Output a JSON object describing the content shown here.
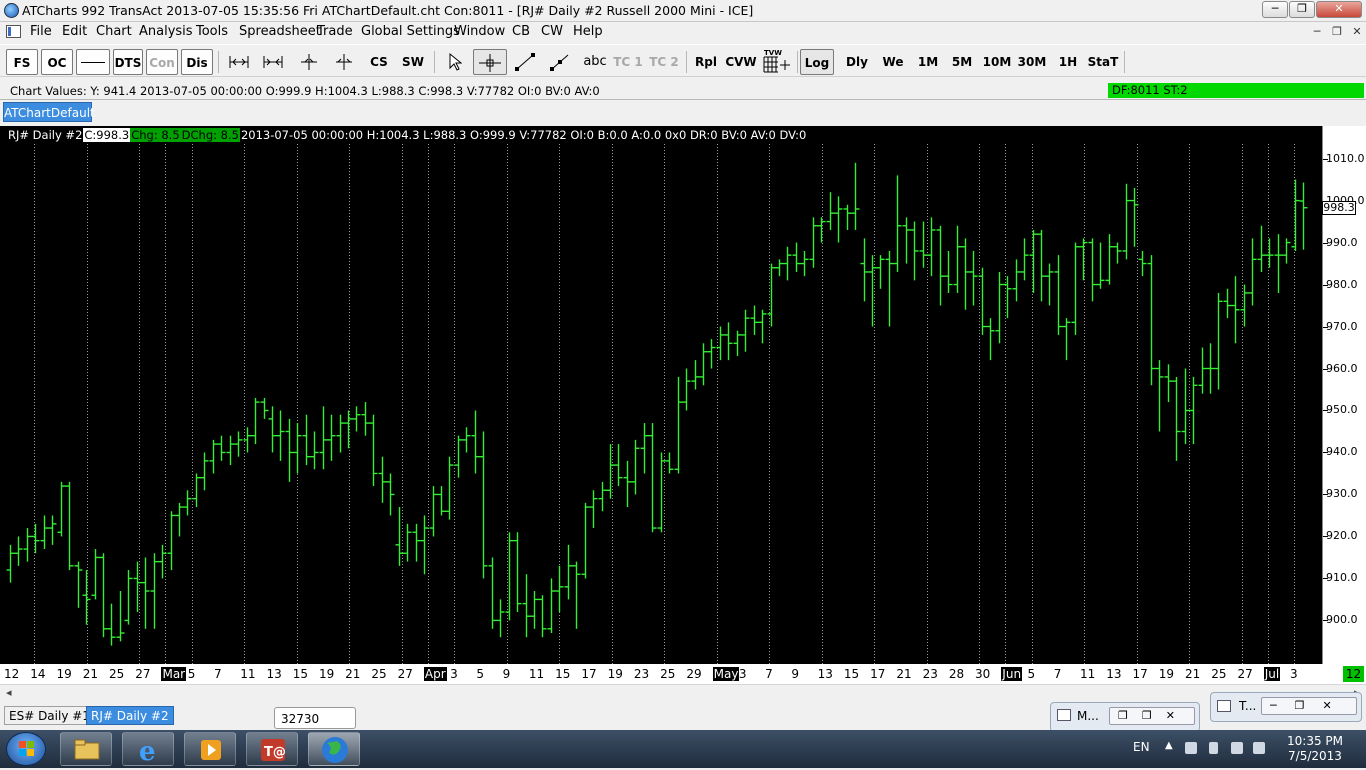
{
  "window": {
    "title": "ATCharts 992 TransAct 2013-07-05  15:35:56 Fri  ATChartDefault.cht Con:8011 - [RJ#  Daily  #2  Russell 2000 Mini - ICE]",
    "minimize": "─",
    "restore": "❐",
    "close": "✕"
  },
  "menu": {
    "items": [
      "File",
      "Edit",
      "Chart",
      "Analysis",
      "Tools",
      "Spreadsheet",
      "Trade",
      "Global Settings",
      "Window",
      "CB",
      "CW",
      "Help"
    ],
    "mdi_minimize": "─",
    "mdi_restore": "❐",
    "mdi_close": "✕"
  },
  "toolbar": {
    "fs": "FS",
    "oc": "OC",
    "dts": "DTS",
    "con": "Con",
    "dis": "Dis",
    "cs": "CS",
    "sw": "SW",
    "abc": "abc",
    "tc1": "TC 1",
    "tc2": "TC 2",
    "rpl": "Rpl",
    "cvw": "CVW",
    "tvw": "TVW",
    "log": "Log",
    "dly": "Dly",
    "we": "We",
    "m1": "1M",
    "m5": "5M",
    "m10": "10M",
    "m30": "30M",
    "h1": "1H",
    "stat": "StaT"
  },
  "values_bar": {
    "text": "Chart Values: Y: 941.4  2013-07-05  00:00:00  O:999.9  H:1004.3  L:988.3  C:998.3  V:77782  OI:0  BV:0  AV:0",
    "df_status": "DF:8011   ST:2"
  },
  "chart_tab": "ATChartDefault",
  "info_line": {
    "symbol": "RJ#  Daily  #2",
    "close": "C:998.3",
    "chg": "Chg: 8.5",
    "dchg": "DChg: 8.5",
    "details": "2013-07-05 00:00:00 H:1004.3 L:988.3 O:999.9 V:77782 OI:0 B:0.0 A:0.0 0x0 DR:0 BV:0 AV:0 DV:0"
  },
  "last_price": "998.3",
  "bottom_tabs": [
    "ES#  Daily  #1",
    "RJ#  Daily  #2"
  ],
  "tooltip": "32730",
  "minimized_windows": [
    {
      "label": "M..."
    },
    {
      "label": "T..."
    }
  ],
  "taskbar": {
    "language": "EN",
    "time": "10:35 PM",
    "date": "7/5/2013"
  },
  "colors": {
    "bars": "#33ee33",
    "chart_bg": "#000000",
    "df_status": "#00d800",
    "tab_active": "#3c8de0"
  },
  "chart_data": {
    "type": "ohlc",
    "ylim": [
      892,
      1013
    ],
    "y_ticks": [
      "1010.0",
      "1000.0",
      "990.0",
      "980.0",
      "970.0",
      "960.0",
      "950.0",
      "940.0",
      "930.0",
      "920.0",
      "910.0",
      "900.0"
    ],
    "y_tick_values": [
      1010,
      1000,
      990,
      980,
      970,
      960,
      950,
      940,
      930,
      920,
      910,
      900
    ],
    "x_labels": [
      "12",
      "14",
      "19",
      "21",
      "25",
      "27",
      "Mar",
      "5",
      "7",
      "11",
      "13",
      "15",
      "19",
      "21",
      "25",
      "27",
      "Apr",
      "3",
      "5",
      "9",
      "11",
      "15",
      "17",
      "19",
      "23",
      "25",
      "29",
      "May",
      "3",
      "7",
      "9",
      "13",
      "15",
      "17",
      "21",
      "23",
      "28",
      "30",
      "Jun",
      "5",
      "7",
      "11",
      "13",
      "17",
      "19",
      "21",
      "25",
      "27",
      "Jul",
      "3"
    ],
    "x_end_label": "12",
    "month_labels": [
      "Mar",
      "Apr",
      "May",
      "Jun",
      "Jul"
    ],
    "bars": [
      {
        "o": 912,
        "h": 918,
        "l": 909,
        "c": 916
      },
      {
        "o": 916,
        "h": 920,
        "l": 913,
        "c": 917
      },
      {
        "o": 917,
        "h": 922,
        "l": 914,
        "c": 920
      },
      {
        "o": 920,
        "h": 923,
        "l": 916,
        "c": 919
      },
      {
        "o": 919,
        "h": 925,
        "l": 917,
        "c": 922
      },
      {
        "o": 922,
        "h": 925,
        "l": 918,
        "c": 923
      },
      {
        "o": 921,
        "h": 933,
        "l": 920,
        "c": 932
      },
      {
        "o": 932,
        "h": 933,
        "l": 912,
        "c": 913
      },
      {
        "o": 913,
        "h": 914,
        "l": 903,
        "c": 912
      },
      {
        "o": 906,
        "h": 912,
        "l": 899,
        "c": 905
      },
      {
        "o": 906,
        "h": 917,
        "l": 905,
        "c": 915
      },
      {
        "o": 915,
        "h": 916,
        "l": 896,
        "c": 898
      },
      {
        "o": 898,
        "h": 904,
        "l": 894,
        "c": 896
      },
      {
        "o": 896,
        "h": 907,
        "l": 895,
        "c": 897
      },
      {
        "o": 900,
        "h": 912,
        "l": 899,
        "c": 910
      },
      {
        "o": 910,
        "h": 914,
        "l": 902,
        "c": 909
      },
      {
        "o": 909,
        "h": 915,
        "l": 898,
        "c": 907
      },
      {
        "o": 907,
        "h": 916,
        "l": 898,
        "c": 914
      },
      {
        "o": 914,
        "h": 918,
        "l": 910,
        "c": 916
      },
      {
        "o": 916,
        "h": 926,
        "l": 912,
        "c": 925
      },
      {
        "o": 925,
        "h": 928,
        "l": 920,
        "c": 927
      },
      {
        "o": 927,
        "h": 931,
        "l": 925,
        "c": 929
      },
      {
        "o": 929,
        "h": 935,
        "l": 927,
        "c": 934
      },
      {
        "o": 934,
        "h": 940,
        "l": 931,
        "c": 938
      },
      {
        "o": 938,
        "h": 943,
        "l": 935,
        "c": 942
      },
      {
        "o": 942,
        "h": 944,
        "l": 938,
        "c": 940
      },
      {
        "o": 940,
        "h": 944,
        "l": 937,
        "c": 942
      },
      {
        "o": 942,
        "h": 945,
        "l": 939,
        "c": 943
      },
      {
        "o": 943,
        "h": 946,
        "l": 940,
        "c": 944
      },
      {
        "o": 944,
        "h": 953,
        "l": 942,
        "c": 952
      },
      {
        "o": 952,
        "h": 953,
        "l": 948,
        "c": 950
      },
      {
        "o": 948,
        "h": 951,
        "l": 940,
        "c": 944
      },
      {
        "o": 944,
        "h": 950,
        "l": 938,
        "c": 945
      },
      {
        "o": 945,
        "h": 948,
        "l": 933,
        "c": 940
      },
      {
        "o": 940,
        "h": 947,
        "l": 935,
        "c": 944
      },
      {
        "o": 944,
        "h": 949,
        "l": 937,
        "c": 939
      },
      {
        "o": 939,
        "h": 945,
        "l": 936,
        "c": 940
      },
      {
        "o": 940,
        "h": 951,
        "l": 936,
        "c": 943
      },
      {
        "o": 943,
        "h": 949,
        "l": 938,
        "c": 944
      },
      {
        "o": 944,
        "h": 949,
        "l": 940,
        "c": 947
      },
      {
        "o": 947,
        "h": 950,
        "l": 941,
        "c": 948
      },
      {
        "o": 948,
        "h": 951,
        "l": 945,
        "c": 949
      },
      {
        "o": 949,
        "h": 952,
        "l": 944,
        "c": 947
      },
      {
        "o": 947,
        "h": 949,
        "l": 932,
        "c": 935
      },
      {
        "o": 935,
        "h": 939,
        "l": 928,
        "c": 933
      },
      {
        "o": 933,
        "h": 935,
        "l": 925,
        "c": 930
      },
      {
        "o": 918,
        "h": 927,
        "l": 913,
        "c": 916
      },
      {
        "o": 916,
        "h": 923,
        "l": 914,
        "c": 921
      },
      {
        "o": 921,
        "h": 923,
        "l": 914,
        "c": 919
      },
      {
        "o": 919,
        "h": 925,
        "l": 911,
        "c": 922
      },
      {
        "o": 922,
        "h": 932,
        "l": 920,
        "c": 930
      },
      {
        "o": 930,
        "h": 932,
        "l": 925,
        "c": 926
      },
      {
        "o": 926,
        "h": 939,
        "l": 924,
        "c": 937
      },
      {
        "o": 937,
        "h": 944,
        "l": 934,
        "c": 943
      },
      {
        "o": 943,
        "h": 946,
        "l": 940,
        "c": 944
      },
      {
        "o": 944,
        "h": 950,
        "l": 935,
        "c": 939
      },
      {
        "o": 939,
        "h": 945,
        "l": 910,
        "c": 913
      },
      {
        "o": 913,
        "h": 915,
        "l": 898,
        "c": 900
      },
      {
        "o": 900,
        "h": 905,
        "l": 896,
        "c": 902
      },
      {
        "o": 902,
        "h": 921,
        "l": 900,
        "c": 919
      },
      {
        "o": 919,
        "h": 921,
        "l": 902,
        "c": 904
      },
      {
        "o": 904,
        "h": 911,
        "l": 896,
        "c": 901
      },
      {
        "o": 901,
        "h": 907,
        "l": 898,
        "c": 905
      },
      {
        "o": 905,
        "h": 906,
        "l": 896,
        "c": 898
      },
      {
        "o": 898,
        "h": 910,
        "l": 897,
        "c": 907
      },
      {
        "o": 907,
        "h": 913,
        "l": 902,
        "c": 908
      },
      {
        "o": 908,
        "h": 918,
        "l": 905,
        "c": 913
      },
      {
        "o": 913,
        "h": 914,
        "l": 898,
        "c": 911
      },
      {
        "o": 911,
        "h": 928,
        "l": 910,
        "c": 927
      },
      {
        "o": 927,
        "h": 931,
        "l": 922,
        "c": 929
      },
      {
        "o": 929,
        "h": 933,
        "l": 926,
        "c": 931
      },
      {
        "o": 931,
        "h": 942,
        "l": 929,
        "c": 937
      },
      {
        "o": 937,
        "h": 942,
        "l": 932,
        "c": 934
      },
      {
        "o": 934,
        "h": 938,
        "l": 927,
        "c": 933
      },
      {
        "o": 933,
        "h": 943,
        "l": 930,
        "c": 941
      },
      {
        "o": 941,
        "h": 947,
        "l": 935,
        "c": 944
      },
      {
        "o": 944,
        "h": 947,
        "l": 921,
        "c": 922
      },
      {
        "o": 922,
        "h": 940,
        "l": 921,
        "c": 938
      },
      {
        "o": 938,
        "h": 940,
        "l": 935,
        "c": 936
      },
      {
        "o": 936,
        "h": 958,
        "l": 935,
        "c": 952
      },
      {
        "o": 952,
        "h": 960,
        "l": 950,
        "c": 957
      },
      {
        "o": 957,
        "h": 962,
        "l": 955,
        "c": 958
      },
      {
        "o": 958,
        "h": 966,
        "l": 956,
        "c": 964
      },
      {
        "o": 964,
        "h": 967,
        "l": 960,
        "c": 965
      },
      {
        "o": 965,
        "h": 970,
        "l": 962,
        "c": 968
      },
      {
        "o": 968,
        "h": 971,
        "l": 962,
        "c": 966
      },
      {
        "o": 966,
        "h": 969,
        "l": 963,
        "c": 968
      },
      {
        "o": 968,
        "h": 974,
        "l": 964,
        "c": 972
      },
      {
        "o": 972,
        "h": 975,
        "l": 968,
        "c": 971
      },
      {
        "o": 971,
        "h": 974,
        "l": 966,
        "c": 973
      },
      {
        "o": 973,
        "h": 985,
        "l": 970,
        "c": 984
      },
      {
        "o": 984,
        "h": 986,
        "l": 982,
        "c": 985
      },
      {
        "o": 985,
        "h": 989,
        "l": 981,
        "c": 987
      },
      {
        "o": 987,
        "h": 990,
        "l": 983,
        "c": 985
      },
      {
        "o": 985,
        "h": 988,
        "l": 982,
        "c": 986
      },
      {
        "o": 986,
        "h": 996,
        "l": 984,
        "c": 994
      },
      {
        "o": 994,
        "h": 996,
        "l": 990,
        "c": 995
      },
      {
        "o": 995,
        "h": 1002,
        "l": 993,
        "c": 997
      },
      {
        "o": 997,
        "h": 1001,
        "l": 990,
        "c": 998
      },
      {
        "o": 998,
        "h": 999,
        "l": 993,
        "c": 997
      },
      {
        "o": 997,
        "h": 1009,
        "l": 993,
        "c": 998
      },
      {
        "o": 985,
        "h": 991,
        "l": 976,
        "c": 983
      },
      {
        "o": 983,
        "h": 987,
        "l": 970,
        "c": 984
      },
      {
        "o": 984,
        "h": 987,
        "l": 979,
        "c": 986
      },
      {
        "o": 986,
        "h": 988,
        "l": 970,
        "c": 985
      },
      {
        "o": 985,
        "h": 1006,
        "l": 983,
        "c": 994
      },
      {
        "o": 994,
        "h": 996,
        "l": 985,
        "c": 993
      },
      {
        "o": 993,
        "h": 995,
        "l": 981,
        "c": 988
      },
      {
        "o": 988,
        "h": 995,
        "l": 984,
        "c": 987
      },
      {
        "o": 987,
        "h": 996,
        "l": 982,
        "c": 993
      },
      {
        "o": 993,
        "h": 994,
        "l": 975,
        "c": 982
      },
      {
        "o": 982,
        "h": 988,
        "l": 978,
        "c": 980
      },
      {
        "o": 980,
        "h": 994,
        "l": 978,
        "c": 989
      },
      {
        "o": 989,
        "h": 991,
        "l": 974,
        "c": 983
      },
      {
        "o": 983,
        "h": 988,
        "l": 975,
        "c": 982
      },
      {
        "o": 982,
        "h": 984,
        "l": 968,
        "c": 970
      },
      {
        "o": 970,
        "h": 972,
        "l": 962,
        "c": 969
      },
      {
        "o": 969,
        "h": 983,
        "l": 966,
        "c": 980
      },
      {
        "o": 980,
        "h": 982,
        "l": 972,
        "c": 979
      },
      {
        "o": 979,
        "h": 986,
        "l": 976,
        "c": 983
      },
      {
        "o": 983,
        "h": 991,
        "l": 981,
        "c": 987
      },
      {
        "o": 987,
        "h": 993,
        "l": 978,
        "c": 992
      },
      {
        "o": 992,
        "h": 993,
        "l": 976,
        "c": 982
      },
      {
        "o": 982,
        "h": 985,
        "l": 975,
        "c": 983
      },
      {
        "o": 983,
        "h": 987,
        "l": 968,
        "c": 970
      },
      {
        "o": 970,
        "h": 972,
        "l": 962,
        "c": 971
      },
      {
        "o": 971,
        "h": 990,
        "l": 968,
        "c": 989
      },
      {
        "o": 989,
        "h": 991,
        "l": 981,
        "c": 990
      },
      {
        "o": 990,
        "h": 991,
        "l": 976,
        "c": 980
      },
      {
        "o": 980,
        "h": 990,
        "l": 979,
        "c": 981
      },
      {
        "o": 981,
        "h": 992,
        "l": 980,
        "c": 989
      },
      {
        "o": 989,
        "h": 990,
        "l": 985,
        "c": 988
      },
      {
        "o": 988,
        "h": 1004,
        "l": 986,
        "c": 1000
      },
      {
        "o": 1000,
        "h": 1003,
        "l": 989,
        "c": 999
      },
      {
        "o": 986,
        "h": 988,
        "l": 982,
        "c": 985
      },
      {
        "o": 985,
        "h": 987,
        "l": 956,
        "c": 960
      },
      {
        "o": 960,
        "h": 962,
        "l": 945,
        "c": 958
      },
      {
        "o": 958,
        "h": 961,
        "l": 952,
        "c": 957
      },
      {
        "o": 957,
        "h": 958,
        "l": 938,
        "c": 945
      },
      {
        "o": 945,
        "h": 960,
        "l": 942,
        "c": 950
      },
      {
        "o": 950,
        "h": 958,
        "l": 942,
        "c": 956
      },
      {
        "o": 956,
        "h": 965,
        "l": 954,
        "c": 960
      },
      {
        "o": 960,
        "h": 966,
        "l": 954,
        "c": 960
      },
      {
        "o": 960,
        "h": 978,
        "l": 955,
        "c": 976
      },
      {
        "o": 976,
        "h": 979,
        "l": 972,
        "c": 975
      },
      {
        "o": 975,
        "h": 982,
        "l": 966,
        "c": 974
      },
      {
        "o": 974,
        "h": 980,
        "l": 970,
        "c": 978
      },
      {
        "o": 978,
        "h": 991,
        "l": 975,
        "c": 986
      },
      {
        "o": 986,
        "h": 994,
        "l": 983,
        "c": 987
      },
      {
        "o": 987,
        "h": 991,
        "l": 984,
        "c": 987
      },
      {
        "o": 987,
        "h": 992,
        "l": 978,
        "c": 987
      },
      {
        "o": 987,
        "h": 991,
        "l": 985,
        "c": 990
      },
      {
        "o": 989,
        "h": 1005,
        "l": 988,
        "c": 1000
      },
      {
        "o": 999.9,
        "h": 1004.3,
        "l": 988.3,
        "c": 998.3
      }
    ]
  }
}
